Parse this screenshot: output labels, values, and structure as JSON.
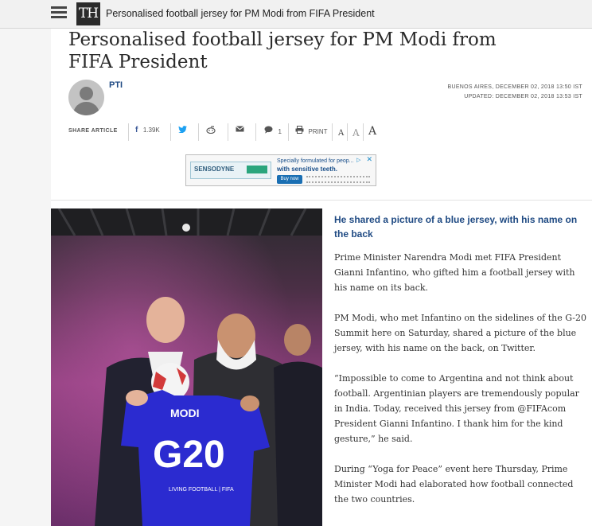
{
  "topbar": {
    "logo": "TH",
    "title": "Personalised football jersey for PM Modi from FIFA President"
  },
  "article": {
    "headline": "Personalised football jersey for PM Modi from FIFA President",
    "author": "PTI",
    "dateline": "BUENOS AIRES, DECEMBER 02, 2018 13:50 IST",
    "updated": "UPDATED: DECEMBER 02, 2018 13:53 IST",
    "subhead": "He shared a picture of a blue jersey, with his name on the back",
    "paragraphs": [
      "Prime Minister Narendra Modi met FIFA President Gianni Infantino, who gifted him a football jersey with his name on its back.",
      "PM Modi, who met Infantino on the sidelines of the G-20 Summit here on Saturday, shared a picture of the blue jersey, with his name on the back, on Twitter.",
      "“Impossible to come to Argentina and not think about football. Argentinian players are tremendously popular in India. Today, received this jersey from @FIFAcom President Gianni Infantino. I thank him for the kind gesture,” he said.",
      "During “Yoga for Peace” event here Thursday, Prime Minister Modi had elaborated how football connected the two countries."
    ]
  },
  "share": {
    "label": "SHARE ARTICLE",
    "facebook_count": "1.39K",
    "comment_count": "1",
    "print_label": "PRINT",
    "font_small": "A",
    "font_medium": "A",
    "font_large": "A"
  },
  "ad": {
    "brand": "SENSODYNE",
    "line1": "Specially formulated for peop...",
    "line2": "with sensitive teeth.",
    "cta": "Buy now",
    "close": "✕"
  },
  "photo": {
    "jersey_name": "MODI",
    "jersey_number": "G20",
    "jersey_slogan": "LIVING FOOTBALL | FIFA"
  },
  "icons": {
    "menu": "hamburger-icon",
    "facebook": "facebook-icon",
    "twitter": "twitter-icon",
    "reddit": "reddit-icon",
    "email": "email-icon",
    "comment": "comment-icon",
    "print": "print-icon"
  },
  "colors": {
    "headline": "#2a2a2a",
    "author": "#1f4a83",
    "subhead": "#1f4a83",
    "jersey_blue": "#2b2bd0"
  }
}
